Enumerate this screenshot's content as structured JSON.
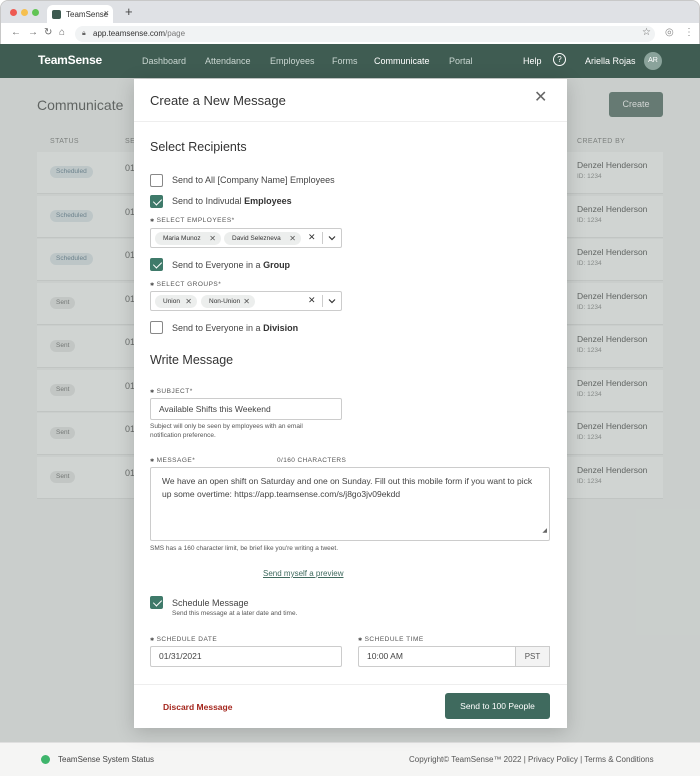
{
  "browser": {
    "tab_title": "TeamSense",
    "url_host": "app.teamsense.com",
    "url_path": "/page"
  },
  "header": {
    "logo": "TeamSense",
    "nav": [
      "Dashboard",
      "Attendance",
      "Employees",
      "Forms",
      "Communicate",
      "Portal"
    ],
    "active_nav": "Communicate",
    "help": "Help",
    "help_icon": "?",
    "user_name": "Ariella Rojas",
    "user_initials": "AR"
  },
  "background": {
    "page_title": "Communicate",
    "create_button": "Create",
    "columns": {
      "status": "STATUS",
      "sent": "SE",
      "created_by": "CREATED BY"
    },
    "rows": [
      {
        "status": "Scheduled",
        "date": "01",
        "creator": "Denzel Henderson",
        "id": "ID: 1234"
      },
      {
        "status": "Scheduled",
        "date": "01",
        "creator": "Denzel Henderson",
        "id": "ID: 1234"
      },
      {
        "status": "Scheduled",
        "date": "01",
        "creator": "Denzel Henderson",
        "id": "ID: 1234"
      },
      {
        "status": "Sent",
        "date": "01",
        "creator": "Denzel Henderson",
        "id": "ID: 1234"
      },
      {
        "status": "Sent",
        "date": "01",
        "creator": "Denzel Henderson",
        "id": "ID: 1234"
      },
      {
        "status": "Sent",
        "date": "01",
        "creator": "Denzel Henderson",
        "id": "ID: 1234"
      },
      {
        "status": "Sent",
        "date": "01",
        "creator": "Denzel Henderson",
        "id": "ID: 1234"
      },
      {
        "status": "Sent",
        "date": "01",
        "creator": "Denzel Henderson",
        "id": "ID: 1234"
      }
    ]
  },
  "footer": {
    "status": "TeamSense System Status",
    "copyright": "Copyright© TeamSense™ 2022",
    "privacy": "Privacy Policy",
    "terms": "Terms & Conditions"
  },
  "modal": {
    "title": "Create a New Message",
    "close_icon": "✕",
    "recipients_heading": "Select Recipients",
    "opt_all": "Send to All [Company Name] Employees",
    "opt_individual_prefix": "Send to Indivudal ",
    "opt_individual_bold": "Employees",
    "select_employees_label": "SELECT EMPLOYEES*",
    "employees": [
      "Maria Munoz",
      "David Selezneva"
    ],
    "opt_group_prefix": "Send to Everyone in a ",
    "opt_group_bold": "Group",
    "select_groups_label": "SELECT GROUPS*",
    "groups": [
      "Union",
      "Non-Union"
    ],
    "opt_division_prefix": "Send to Everyone in a ",
    "opt_division_bold": "Division",
    "write_heading": "Write Message",
    "subject_label": "SUBJECT*",
    "subject_value": "Available Shifts this Weekend",
    "subject_hint_1": "Subject will only be seen by employees with an email",
    "subject_hint_2": "notification preference.",
    "message_label": "MESSAGE*",
    "char_count": "0/160 CHARACTERS",
    "message_value": "We have an open shift on Saturday and one on Sunday.  Fill out this mobile form if you want to pick up some overtime: https://app.teamsense.com/s/j8go3jv09ekdd",
    "sms_hint": "SMS has a 160 character limit, be brief like you're writing a tweet.",
    "preview_link": "Send myself a preview",
    "schedule_label": "Schedule Message",
    "schedule_hint": "Send this message at a later date and time.",
    "schedule_date_label": "SCHEDULE DATE",
    "schedule_date": "01/31/2021",
    "schedule_time_label": "SCHEDULE TIME",
    "schedule_time": "10:00 AM",
    "timezone": "PST",
    "discard": "Discard Message",
    "send": "Send to 100 People"
  },
  "colors": {
    "brand": "#3f5c52",
    "accent": "#3f6a5e",
    "danger": "#a4261d",
    "status_ok": "#3fb56c"
  }
}
